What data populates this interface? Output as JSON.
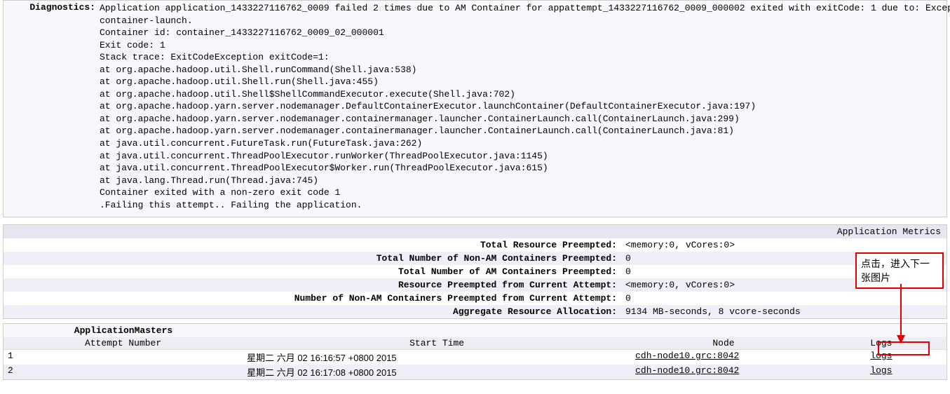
{
  "diagnostics": {
    "label": "Diagnostics:",
    "content": "Application application_1433227116762_0009 failed 2 times due to AM Container for appattempt_1433227116762_0009_000002 exited with exitCode: 1 due to: Exception from\ncontainer-launch.\nContainer id: container_1433227116762_0009_02_000001\nExit code: 1\nStack trace: ExitCodeException exitCode=1:\nat org.apache.hadoop.util.Shell.runCommand(Shell.java:538)\nat org.apache.hadoop.util.Shell.run(Shell.java:455)\nat org.apache.hadoop.util.Shell$ShellCommandExecutor.execute(Shell.java:702)\nat org.apache.hadoop.yarn.server.nodemanager.DefaultContainerExecutor.launchContainer(DefaultContainerExecutor.java:197)\nat org.apache.hadoop.yarn.server.nodemanager.containermanager.launcher.ContainerLaunch.call(ContainerLaunch.java:299)\nat org.apache.hadoop.yarn.server.nodemanager.containermanager.launcher.ContainerLaunch.call(ContainerLaunch.java:81)\nat java.util.concurrent.FutureTask.run(FutureTask.java:262)\nat java.util.concurrent.ThreadPoolExecutor.runWorker(ThreadPoolExecutor.java:1145)\nat java.util.concurrent.ThreadPoolExecutor$Worker.run(ThreadPoolExecutor.java:615)\nat java.lang.Thread.run(Thread.java:745)\nContainer exited with a non-zero exit code 1\n.Failing this attempt.. Failing the application."
  },
  "metrics": {
    "header": "Application Metrics",
    "rows": [
      {
        "label": "Total Resource Preempted:",
        "value": "<memory:0, vCores:0>"
      },
      {
        "label": "Total Number of Non-AM Containers Preempted:",
        "value": "0"
      },
      {
        "label": "Total Number of AM Containers Preempted:",
        "value": "0"
      },
      {
        "label": "Resource Preempted from Current Attempt:",
        "value": "<memory:0, vCores:0>"
      },
      {
        "label": "Number of Non-AM Containers Preempted from Current Attempt:",
        "value": "0"
      },
      {
        "label": "Aggregate Resource Allocation:",
        "value": "9134 MB-seconds, 8 vcore-seconds"
      }
    ]
  },
  "masters": {
    "title": "ApplicationMasters",
    "headers": {
      "attempt": "Attempt Number",
      "start": "Start Time",
      "node": "Node",
      "logs": "Logs"
    },
    "rows": [
      {
        "attempt": "1",
        "start": "星期二 六月 02 16:16:57 +0800 2015",
        "node": "cdh-node10.grc:8042",
        "logs": "logs"
      },
      {
        "attempt": "2",
        "start": "星期二 六月 02 16:17:08 +0800 2015",
        "node": "cdh-node10.grc:8042",
        "logs": "logs"
      }
    ]
  },
  "annotation": {
    "text": "点击，进入下一张图片"
  }
}
